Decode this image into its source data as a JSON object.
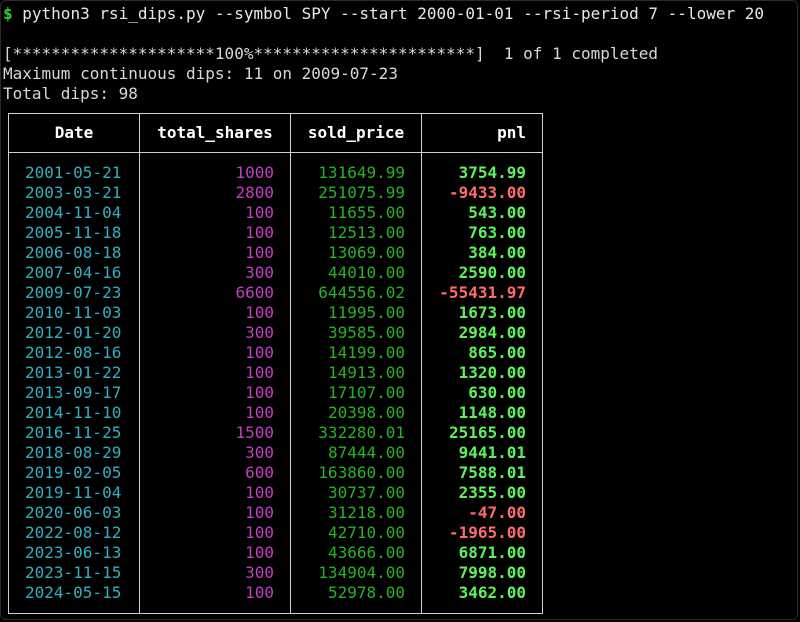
{
  "terminal": {
    "prompt": "$",
    "command": " python3 rsi_dips.py --symbol SPY --start 2000-01-01 --rsi-period 7 --lower 20",
    "progress": "[*********************100%***********************]  1 of 1 completed",
    "max_dips": "Maximum continuous dips: 11 on 2009-07-23",
    "total_dips": "Total dips: 98"
  },
  "table": {
    "headers": [
      "Date",
      "total_shares",
      "sold_price",
      "pnl"
    ],
    "rows": [
      {
        "date": "2001-05-21",
        "shares": "1000",
        "price": "131649.99",
        "pnl": "3754.99",
        "sign": "pos"
      },
      {
        "date": "2003-03-21",
        "shares": "2800",
        "price": "251075.99",
        "pnl": "-9433.00",
        "sign": "neg"
      },
      {
        "date": "2004-11-04",
        "shares": "100",
        "price": "11655.00",
        "pnl": "543.00",
        "sign": "pos"
      },
      {
        "date": "2005-11-18",
        "shares": "100",
        "price": "12513.00",
        "pnl": "763.00",
        "sign": "pos"
      },
      {
        "date": "2006-08-18",
        "shares": "100",
        "price": "13069.00",
        "pnl": "384.00",
        "sign": "pos"
      },
      {
        "date": "2007-04-16",
        "shares": "300",
        "price": "44010.00",
        "pnl": "2590.00",
        "sign": "pos"
      },
      {
        "date": "2009-07-23",
        "shares": "6600",
        "price": "644556.02",
        "pnl": "-55431.97",
        "sign": "neg"
      },
      {
        "date": "2010-11-03",
        "shares": "100",
        "price": "11995.00",
        "pnl": "1673.00",
        "sign": "pos"
      },
      {
        "date": "2012-01-20",
        "shares": "300",
        "price": "39585.00",
        "pnl": "2984.00",
        "sign": "pos"
      },
      {
        "date": "2012-08-16",
        "shares": "100",
        "price": "14199.00",
        "pnl": "865.00",
        "sign": "pos"
      },
      {
        "date": "2013-01-22",
        "shares": "100",
        "price": "14913.00",
        "pnl": "1320.00",
        "sign": "pos"
      },
      {
        "date": "2013-09-17",
        "shares": "100",
        "price": "17107.00",
        "pnl": "630.00",
        "sign": "pos"
      },
      {
        "date": "2014-11-10",
        "shares": "100",
        "price": "20398.00",
        "pnl": "1148.00",
        "sign": "pos"
      },
      {
        "date": "2016-11-25",
        "shares": "1500",
        "price": "332280.01",
        "pnl": "25165.00",
        "sign": "pos"
      },
      {
        "date": "2018-08-29",
        "shares": "300",
        "price": "87444.00",
        "pnl": "9441.01",
        "sign": "pos"
      },
      {
        "date": "2019-02-05",
        "shares": "600",
        "price": "163860.00",
        "pnl": "7588.01",
        "sign": "pos"
      },
      {
        "date": "2019-11-04",
        "shares": "100",
        "price": "30737.00",
        "pnl": "2355.00",
        "sign": "pos"
      },
      {
        "date": "2020-06-03",
        "shares": "100",
        "price": "31218.00",
        "pnl": "-47.00",
        "sign": "neg"
      },
      {
        "date": "2022-08-12",
        "shares": "100",
        "price": "42710.00",
        "pnl": "-1965.00",
        "sign": "neg"
      },
      {
        "date": "2023-06-13",
        "shares": "100",
        "price": "43666.00",
        "pnl": "6871.00",
        "sign": "pos"
      },
      {
        "date": "2023-11-15",
        "shares": "300",
        "price": "134904.00",
        "pnl": "7998.00",
        "sign": "pos"
      },
      {
        "date": "2024-05-15",
        "shares": "100",
        "price": "52978.00",
        "pnl": "3462.00",
        "sign": "pos"
      }
    ]
  },
  "colors": {
    "background": "#000000",
    "prompt": "#2fd22f",
    "date": "#2fb0c2",
    "shares": "#c33fbe",
    "price": "#25b325",
    "pnl_positive": "#5cf25c",
    "pnl_negative": "#ff6b6b"
  }
}
